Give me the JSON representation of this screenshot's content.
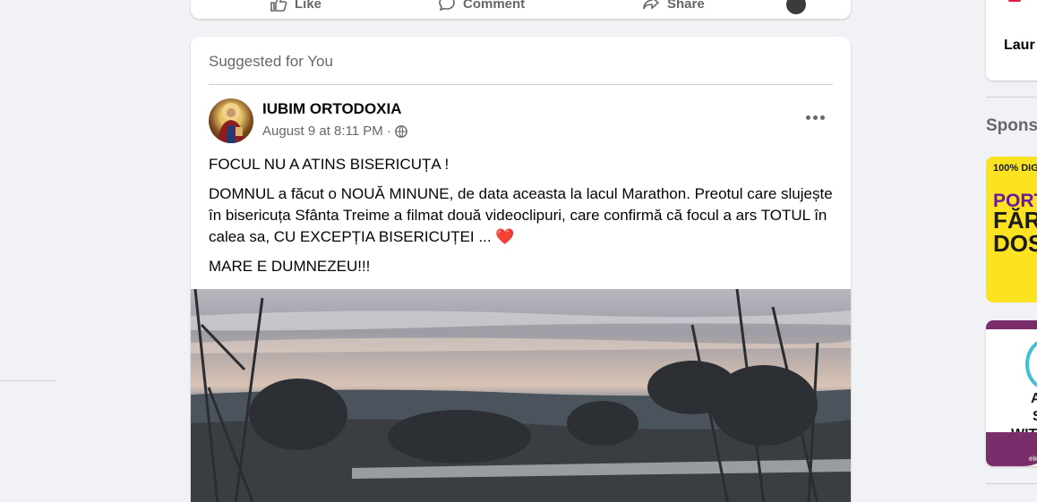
{
  "prev_post": {
    "like_label": "Like",
    "comment_label": "Comment",
    "share_label": "Share"
  },
  "card": {
    "suggested_label": "Suggested for You",
    "page_name": "IUBIM ORTODOXIA",
    "timestamp": "August 9 at 8:11 PM",
    "meta_separator": "·",
    "paragraphs": [
      "FOCUL NU A ATINS BISERICUȚA !",
      "DOMNUL a făcut o NOUĂ MINUNE, de data aceasta la lacul Marathon. Preotul care slujește în bisericuța Sfânta Treime a filmat două videoclipuri, care confirmă că focul a ars TOTUL în calea sa, CU EXCEPȚIA BISERICUȚEI ...",
      "MARE E DUMNEZEU!!!"
    ],
    "heart_emoji": "❤️"
  },
  "right_rail": {
    "contact_name": "Laur",
    "sponsored_label": "Spons",
    "ad1": {
      "line1": "100% DIG",
      "line2": "PORTA",
      "line3": "FĂRĂ",
      "line4": "DOS"
    },
    "ad2": {
      "line1": "A",
      "line2": "S",
      "line3": "WITH",
      "small": "ele"
    }
  }
}
